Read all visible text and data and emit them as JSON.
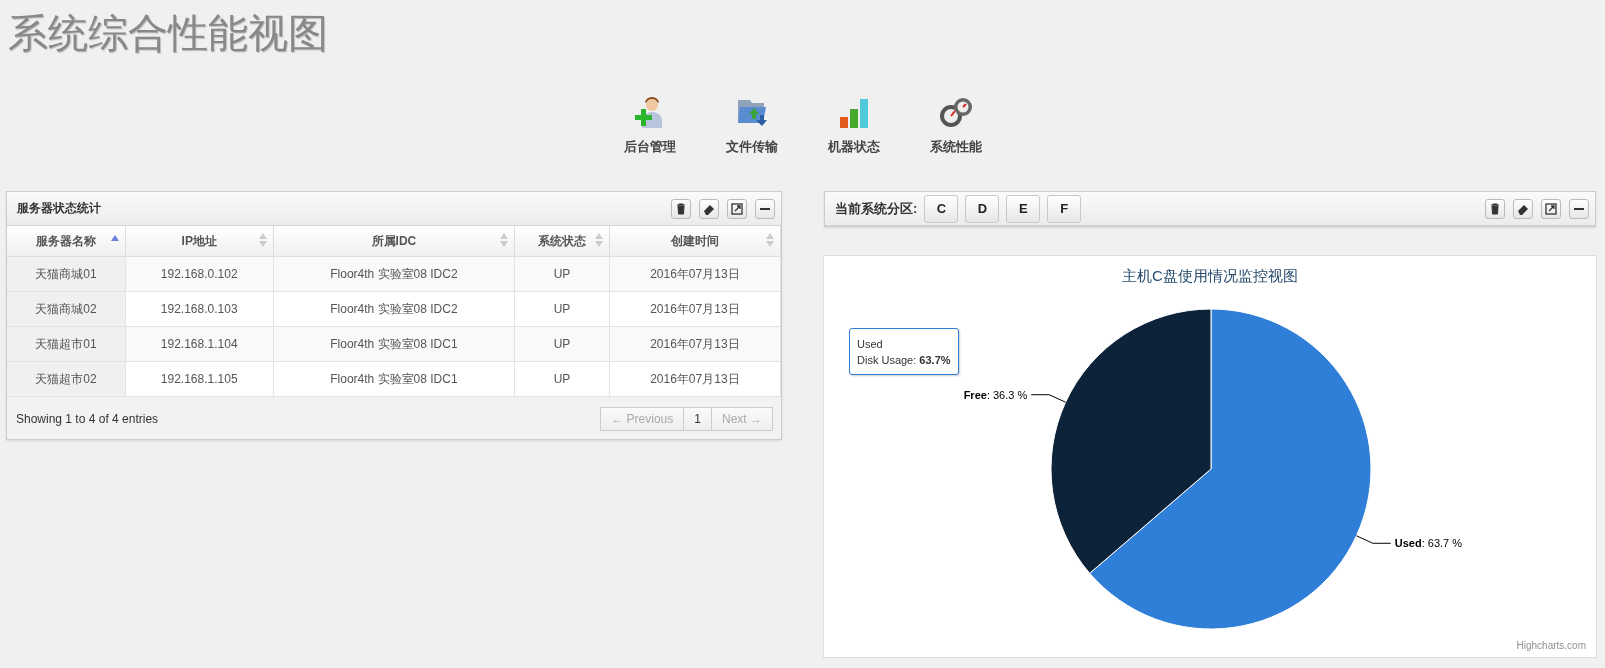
{
  "page_title": "系统综合性能视图",
  "nav_items": [
    {
      "label": "后台管理",
      "kind": "user"
    },
    {
      "label": "文件传输",
      "kind": "folder"
    },
    {
      "label": "机器状态",
      "kind": "bars"
    },
    {
      "label": "系统性能",
      "kind": "gauge"
    }
  ],
  "server_panel": {
    "title": "服务器状态统计",
    "table": {
      "columns": [
        {
          "label": "服务器名称",
          "sorted": true
        },
        {
          "label": "IP地址",
          "sorted": false
        },
        {
          "label": "所属IDC",
          "sorted": false
        },
        {
          "label": "系统状态",
          "sorted": false
        },
        {
          "label": "创建时间",
          "sorted": false
        }
      ],
      "rows": [
        [
          "天猫商城01",
          "192.168.0.102",
          "Floor4th 实验室08 IDC2",
          "UP",
          "2016年07月13日"
        ],
        [
          "天猫商城02",
          "192.168.0.103",
          "Floor4th 实验室08 IDC2",
          "UP",
          "2016年07月13日"
        ],
        [
          "天猫超市01",
          "192.168.1.104",
          "Floor4th 实验室08 IDC1",
          "UP",
          "2016年07月13日"
        ],
        [
          "天猫超市02",
          "192.168.1.105",
          "Floor4th 实验室08 IDC1",
          "UP",
          "2016年07月13日"
        ]
      ]
    },
    "info": "Showing 1 to 4 of 4 entries",
    "pagination": [
      {
        "label": "← Previous",
        "disabled": true
      },
      {
        "label": "1",
        "disabled": false
      },
      {
        "label": "Next →",
        "disabled": true
      }
    ]
  },
  "partition_panel": {
    "label": "当前系统分区:",
    "partitions": [
      "C",
      "D",
      "E",
      "F"
    ]
  },
  "chart_panel": {
    "chart_data": {
      "type": "pie",
      "title": "主机C盘使用情况监控视图",
      "series": [
        {
          "colors": [
            "#2f7ed8",
            "#0d233a"
          ],
          "values": [
            63.7,
            36.3
          ]
        }
      ],
      "value_labels": [
        "**Used**: 63.7 %",
        "**Free**: 36.3 %"
      ]
    },
    "tooltip": {
      "title": "Used",
      "text": "Disk Usage: **63.7%**"
    },
    "credit": "Highcharts.com"
  }
}
